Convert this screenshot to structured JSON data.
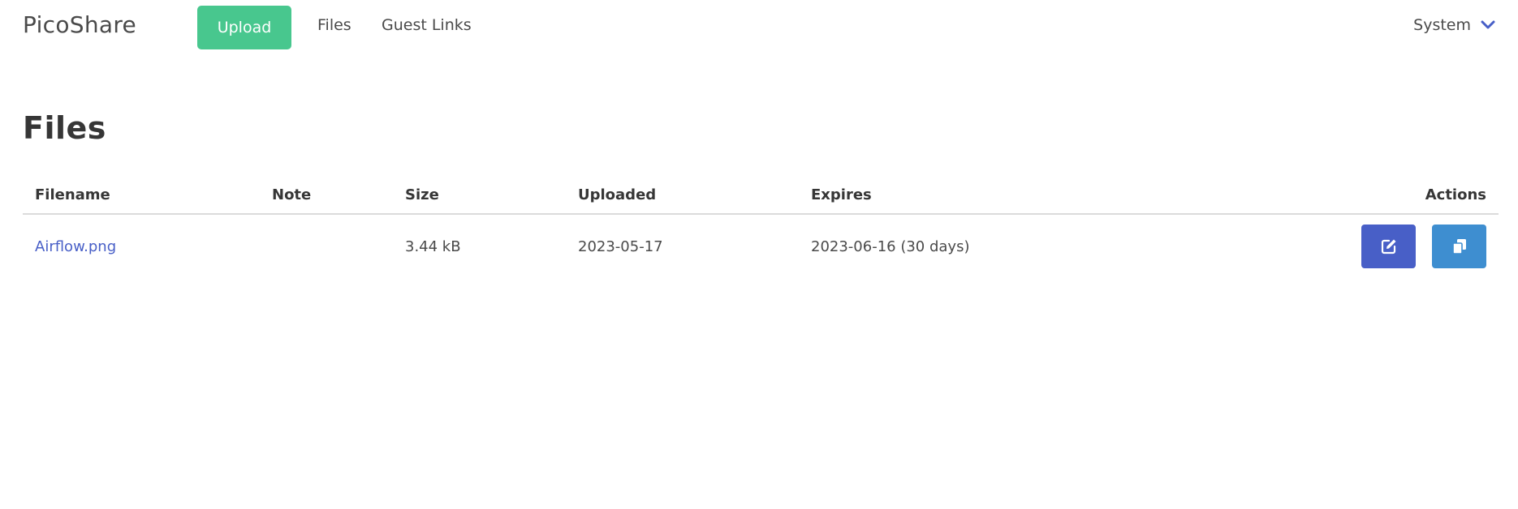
{
  "navbar": {
    "brand": "PicoShare",
    "upload_label": "Upload",
    "links": [
      {
        "label": "Files"
      },
      {
        "label": "Guest Links"
      }
    ],
    "system_label": "System",
    "system_icon": "chevron-down-icon"
  },
  "page": {
    "title": "Files"
  },
  "table": {
    "columns": [
      "Filename",
      "Note",
      "Size",
      "Uploaded",
      "Expires",
      "Actions"
    ],
    "rows": [
      {
        "filename": "Airflow.png",
        "note": "",
        "size": "3.44 kB",
        "uploaded": "2023-05-17",
        "expires": "2023-06-16 (30 days)",
        "actions": [
          "edit-icon",
          "copy-icon"
        ]
      }
    ]
  },
  "colors": {
    "upload": "#48c78e",
    "edit": "#485fc7",
    "copy": "#3e8ed0",
    "link": "#485fc7"
  }
}
